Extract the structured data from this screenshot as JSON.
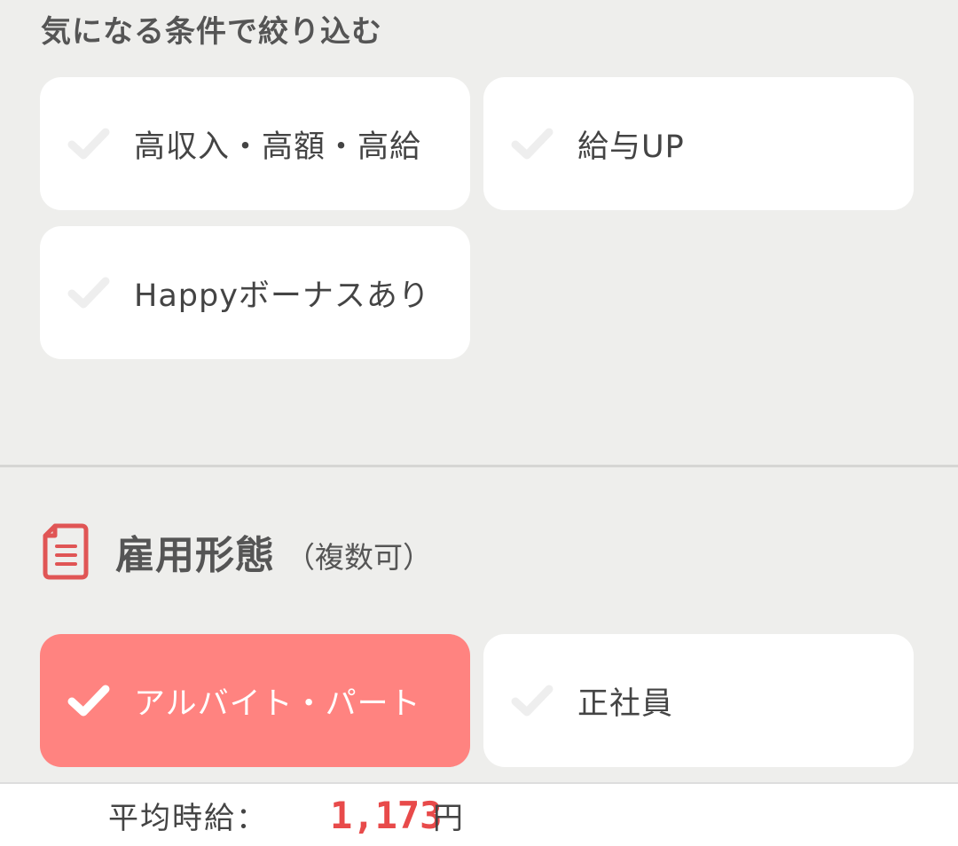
{
  "filter": {
    "heading": "気になる条件で絞り込む",
    "options": [
      {
        "label": "高収入・高額・高給",
        "checked": false
      },
      {
        "label": "給与UP",
        "checked": false
      },
      {
        "label": "Happyボーナスあり",
        "checked": false
      }
    ]
  },
  "employment": {
    "title": "雇用形態",
    "subtitle": "（複数可）",
    "icon": "document-icon",
    "options": [
      {
        "label": "アルバイト・パート",
        "checked": true
      },
      {
        "label": "正社員",
        "checked": false
      }
    ]
  },
  "footer": {
    "avg_label": "平均時給：",
    "avg_value": "1,173",
    "avg_unit": "円"
  },
  "colors": {
    "accent": "#ff8380",
    "price": "#e84a4a",
    "check_off": "#eeeeee"
  }
}
